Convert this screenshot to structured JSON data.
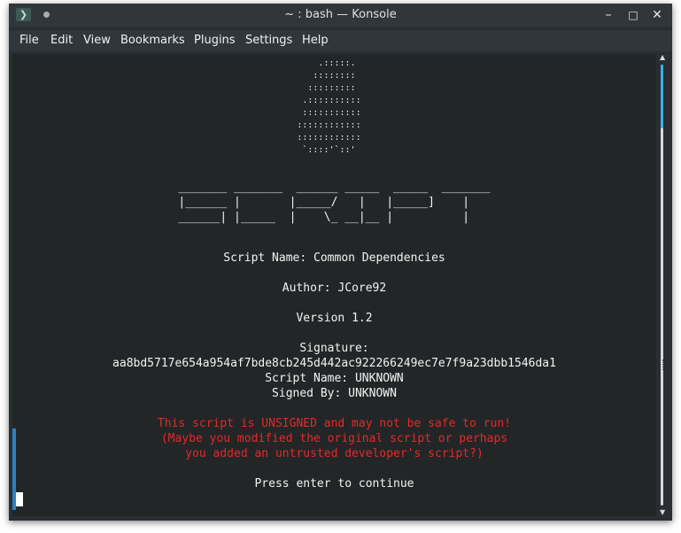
{
  "window": {
    "title": "~ : bash — Konsole"
  },
  "controls": {
    "minimize": "–",
    "maximize": "□",
    "close": "✕"
  },
  "icons": {
    "app": "konsole-terminal-icon",
    "pin": "pin-dot-icon"
  },
  "menu": [
    "File",
    "Edit",
    "View",
    "Bookmarks",
    "Plugins",
    "Settings",
    "Help"
  ],
  "terminal": {
    "logo_art": "      .:::::.     \n     ::::::::     \n    :::::::::     \n   .::::::::::    \n   :::::::::::    \n  ::::::::::::    \n  ::::::::::::    \n   `::::'`::'     ",
    "banner_art": "_______ _______  ______ _____  _____  _______\n|______ |       |_____/   |   |_____]    |   \n______| |_____  |    \\_ __|__ |          |   ",
    "script_name": "Script Name: Common Dependencies",
    "author": "Author: JCore92",
    "version": "Version 1.2",
    "signature_label": "Signature:",
    "signature_hash": "aa8bd5717e654a954af7bde8cb245d442ac922266249ec7e7f9a23dbb1546da1",
    "signed_script_name": "Script Name: UNKNOWN",
    "signed_by": "Signed By: UNKNOWN",
    "warning_1": "This script is UNSIGNED and may not be safe to run!",
    "warning_2": "(Maybe you modified the original script or perhaps",
    "warning_3": "you added an untrusted developer's script?)",
    "prompt": "Press enter to continue"
  },
  "colors": {
    "warning": "#e62828",
    "accent": "#3daee9",
    "background": "#232627"
  }
}
